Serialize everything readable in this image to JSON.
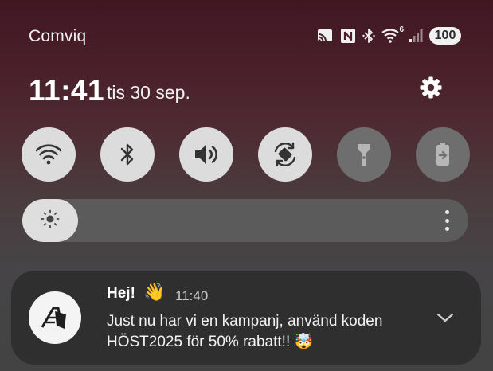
{
  "status_bar": {
    "carrier": "Comviq",
    "icons": [
      "cast-icon",
      "nfc-icon",
      "bluetooth-icon",
      "wifi-icon",
      "signal-icon"
    ],
    "wifi_badge": "6",
    "battery": "100"
  },
  "header": {
    "time": "11:41",
    "date": "tis 30 sep.",
    "settings_icon": "gear-icon"
  },
  "quick_tiles": [
    {
      "name": "wifi",
      "icon": "wifi-icon",
      "state": "on"
    },
    {
      "name": "bluetooth",
      "icon": "bluetooth-icon",
      "state": "on"
    },
    {
      "name": "sound",
      "icon": "volume-icon",
      "state": "on"
    },
    {
      "name": "auto-rotate",
      "icon": "rotate-icon",
      "state": "on"
    },
    {
      "name": "flashlight",
      "icon": "flashlight-icon",
      "state": "off"
    },
    {
      "name": "power-share",
      "icon": "battery-share-icon",
      "state": "off"
    }
  ],
  "brightness": {
    "level": 0.06,
    "icon": "sun-icon"
  },
  "notification": {
    "title": "Hej!",
    "title_emoji": "👋",
    "time": "11:40",
    "body": "Just nu har vi en kampanj, använd koden HÖST2025 för 50% rabatt!!",
    "body_emoji": "🤯"
  },
  "colors": {
    "tile_on": "#dcdcdc",
    "tile_off": "#6e6e6f",
    "notification_bg": "#2f2f30",
    "background_top": "#3f1722"
  }
}
